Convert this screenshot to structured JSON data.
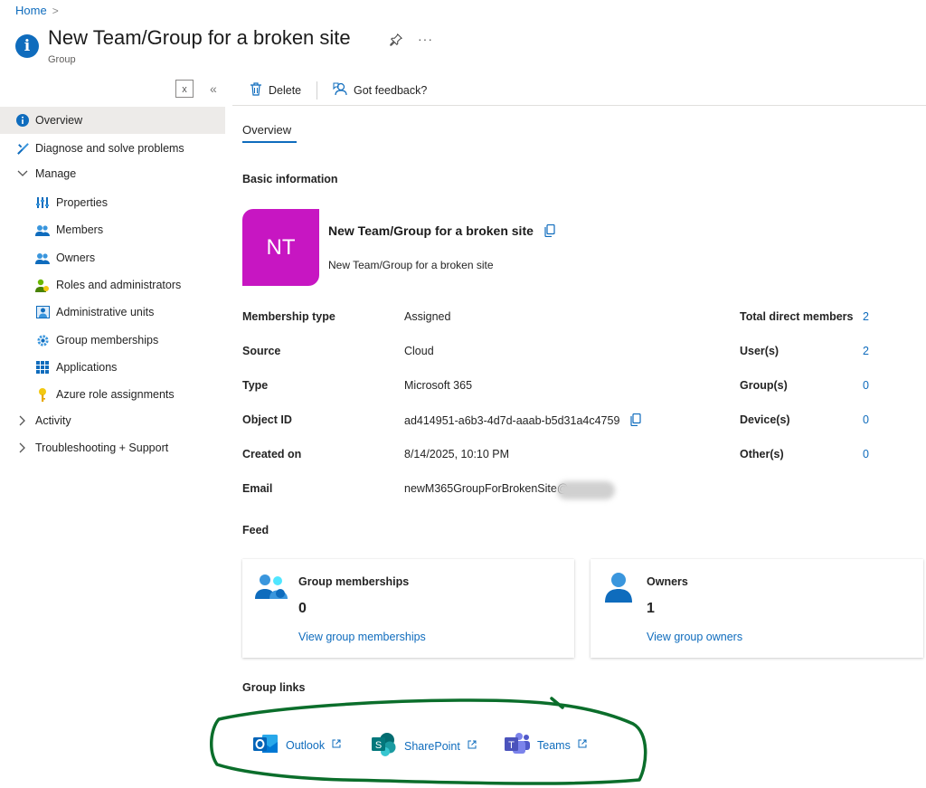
{
  "breadcrumb": {
    "home": "Home",
    "separator": ">"
  },
  "header": {
    "title": "New Team/Group for a broken site",
    "subtitle": "Group",
    "pin_icon": "pin-icon",
    "more": "···"
  },
  "sidebar": {
    "search_clear": "x",
    "collapse": "«",
    "items": [
      {
        "label": "Overview",
        "icon": "info-icon",
        "active": true
      },
      {
        "label": "Diagnose and solve problems",
        "icon": "wrench-icon"
      },
      {
        "label": "Manage",
        "icon": "chevron-down-icon"
      },
      {
        "label": "Properties",
        "icon": "properties-icon"
      },
      {
        "label": "Members",
        "icon": "members-icon"
      },
      {
        "label": "Owners",
        "icon": "owners-icon"
      },
      {
        "label": "Roles and administrators",
        "icon": "roles-icon"
      },
      {
        "label": "Administrative units",
        "icon": "admin-units-icon"
      },
      {
        "label": "Group memberships",
        "icon": "gear-icon"
      },
      {
        "label": "Applications",
        "icon": "apps-grid-icon"
      },
      {
        "label": "Azure role assignments",
        "icon": "key-icon"
      },
      {
        "label": "Activity",
        "icon": "chevron-right-icon"
      },
      {
        "label": "Troubleshooting + Support",
        "icon": "chevron-right-icon"
      }
    ]
  },
  "toolbar": {
    "delete_label": "Delete",
    "feedback_label": "Got feedback?"
  },
  "tabs": {
    "overview": "Overview"
  },
  "basic_info": {
    "heading": "Basic information",
    "avatar_initials": "NT",
    "name": "New Team/Group for a broken site",
    "description": "New Team/Group for a broken site",
    "properties": [
      {
        "label": "Membership type",
        "value": "Assigned"
      },
      {
        "label": "Source",
        "value": "Cloud"
      },
      {
        "label": "Type",
        "value": "Microsoft 365"
      },
      {
        "label": "Object ID",
        "value": "ad414951-a6b3-4d7d-aaab-b5d31a4c4759"
      },
      {
        "label": "Created on",
        "value": "8/14/2025, 10:10 PM"
      },
      {
        "label": "Email",
        "value": "newM365GroupForBrokenSite@"
      }
    ],
    "stats": [
      {
        "label": "Total direct members",
        "value": "2"
      },
      {
        "label": "User(s)",
        "value": "2"
      },
      {
        "label": "Group(s)",
        "value": "0"
      },
      {
        "label": "Device(s)",
        "value": "0"
      },
      {
        "label": "Other(s)",
        "value": "0"
      }
    ]
  },
  "feed": {
    "heading": "Feed",
    "cards": [
      {
        "title": "Group memberships",
        "count": "0",
        "link": "View group memberships"
      },
      {
        "title": "Owners",
        "count": "1",
        "link": "View group owners"
      }
    ]
  },
  "group_links": {
    "heading": "Group links",
    "links": [
      {
        "label": "Outlook",
        "icon": "outlook-icon"
      },
      {
        "label": "SharePoint",
        "icon": "sharepoint-icon"
      },
      {
        "label": "Teams",
        "icon": "teams-icon"
      }
    ],
    "highlight_color": "#0b6e2b"
  },
  "colors": {
    "accent": "#0f6cbd",
    "avatar": "#c716c2"
  }
}
